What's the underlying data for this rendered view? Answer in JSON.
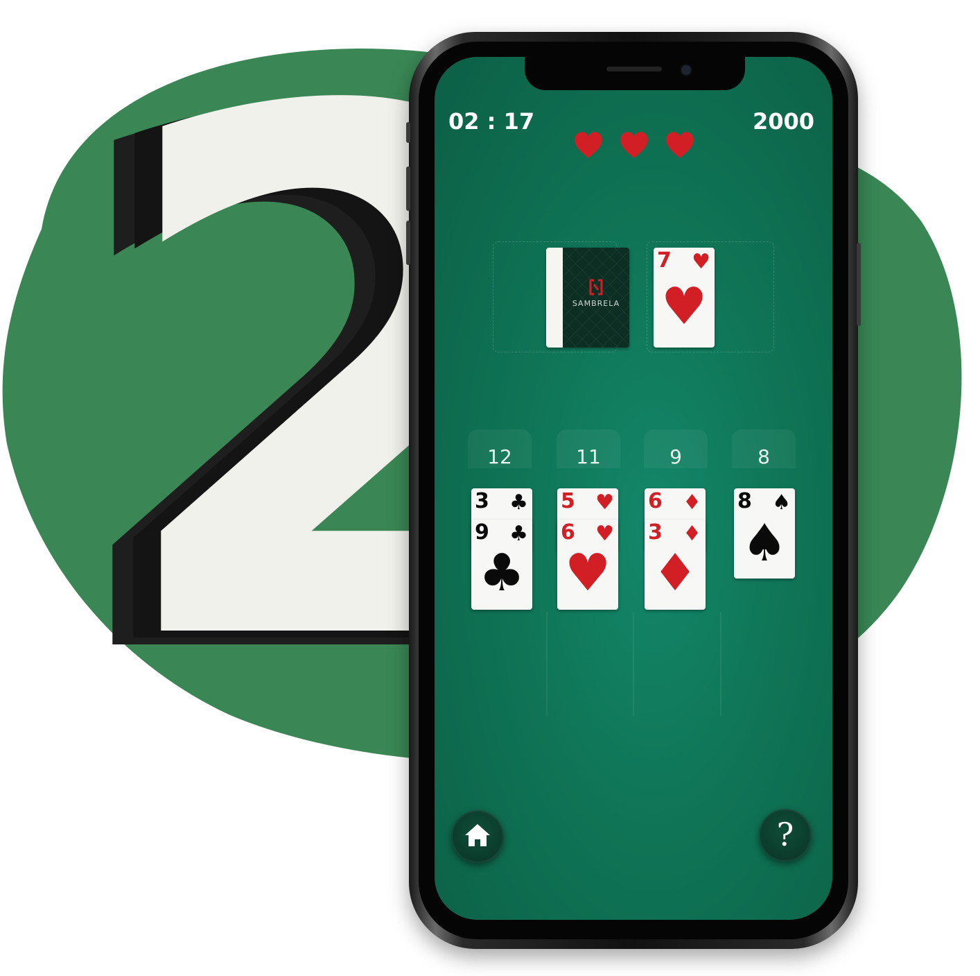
{
  "game": {
    "timer": "02 : 17",
    "score": "2000",
    "lives": 3
  },
  "stock": {
    "brand": "SAMBRELA"
  },
  "waste_card": {
    "rank": "7",
    "suit": "hearts",
    "suit_symbol": "♥",
    "color": "#d21f25"
  },
  "columns": [
    {
      "count": "12",
      "cards": [
        {
          "rank": "3",
          "suit_symbol": "♣",
          "color": "black"
        },
        {
          "rank": "9",
          "suit_symbol": "♣",
          "color": "black"
        }
      ]
    },
    {
      "count": "11",
      "cards": [
        {
          "rank": "5",
          "suit_symbol": "♥",
          "color": "red"
        },
        {
          "rank": "6",
          "suit_symbol": "♥",
          "color": "red"
        }
      ]
    },
    {
      "count": "9",
      "cards": [
        {
          "rank": "6",
          "suit_symbol": "♦",
          "color": "red"
        },
        {
          "rank": "3",
          "suit_symbol": "♦",
          "color": "red"
        }
      ]
    },
    {
      "count": "8",
      "cards": [
        {
          "rank": "8",
          "suit_symbol": "♠",
          "color": "black"
        }
      ]
    }
  ],
  "decoration": {
    "big_number": "2"
  },
  "buttons": {
    "help_label": "?"
  },
  "colors": {
    "felt": "#0f7455",
    "blob": "#3a8755",
    "heart": "#d21f25"
  }
}
